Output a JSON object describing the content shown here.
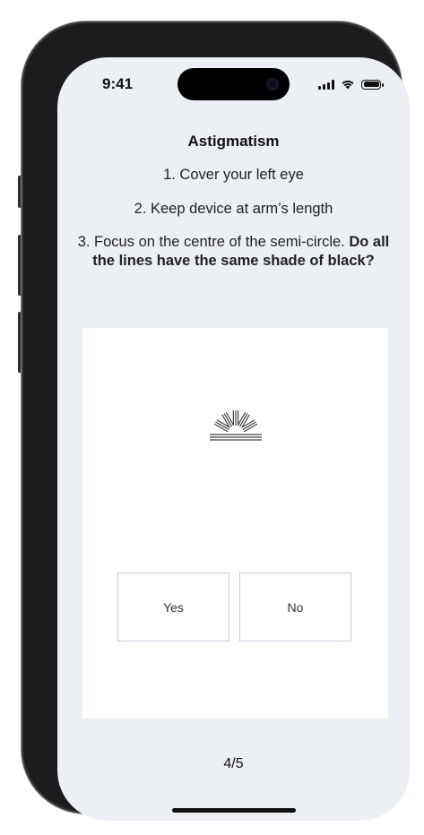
{
  "status_bar": {
    "time": "9:41"
  },
  "screen": {
    "title": "Astigmatism",
    "steps": [
      "1. Cover your left eye",
      "2. Keep device at arm’s length"
    ],
    "step3_text": "3. Focus on the centre of the semi-circle. ",
    "step3_question": "Do all the lines have the same shade of black?"
  },
  "test_card": {
    "chart_icon": "astigmatism-sunburst-icon",
    "yes_label": "Yes",
    "no_label": "No"
  },
  "progress": {
    "label": "4/5",
    "current": 4,
    "total": 5
  }
}
